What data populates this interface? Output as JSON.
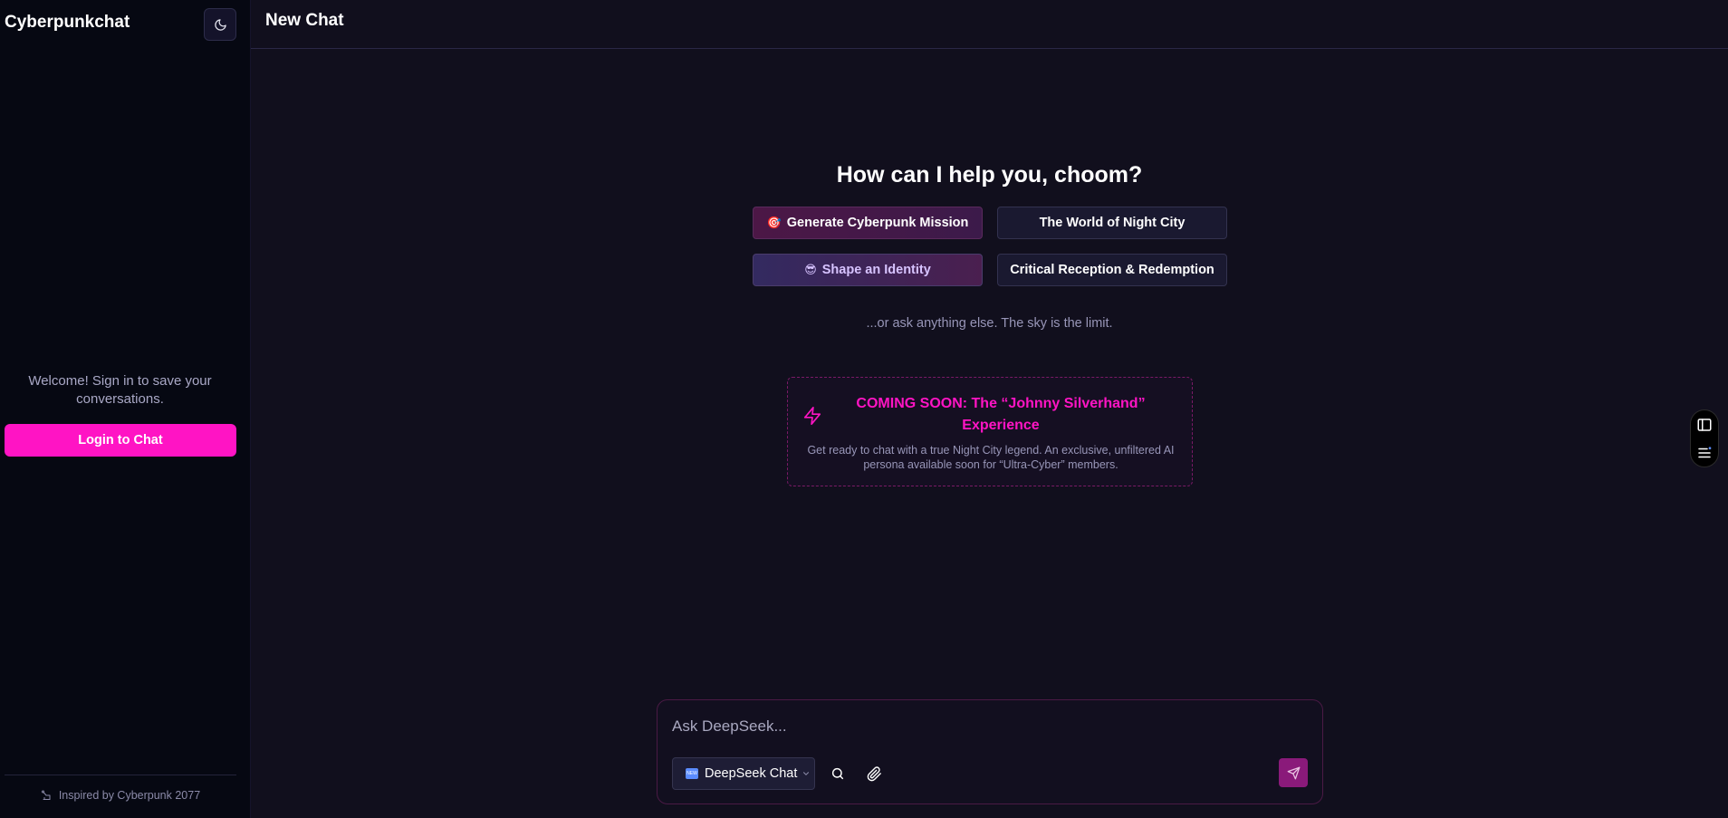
{
  "sidebar": {
    "brand": "Cyberpunkchat",
    "theme_toggle_icon": "moon-icon",
    "welcome_text": "Welcome! Sign in to save your conversations.",
    "login_label": "Login to Chat",
    "footer_icon": "robot-arm-icon",
    "footer_text": "Inspired by Cyberpunk 2077"
  },
  "header": {
    "title": "New Chat"
  },
  "main": {
    "hero_title": "How can I help you, choom?",
    "suggestions": [
      {
        "emoji": "🎯",
        "label": "Generate Cyberpunk Mission"
      },
      {
        "emoji": "",
        "label": "The World of Night City"
      },
      {
        "emoji": "😎",
        "label": "Shape an Identity"
      },
      {
        "emoji": "",
        "label": "Critical Reception & Redemption"
      }
    ],
    "hint": "...or ask anything else. The sky is the limit.",
    "promo": {
      "icon": "lightning-icon",
      "title": "COMING SOON: The “Johnny Silverhand” Experience",
      "text": "Get ready to chat with a true Night City legend. An exclusive, unfiltered AI persona available soon for “Ultra-Cyber” members."
    }
  },
  "composer": {
    "placeholder": "Ask DeepSeek...",
    "model_label": "DeepSeek Chat",
    "model_badge": "NEW",
    "search_icon": "search-icon",
    "attach_icon": "paperclip-icon",
    "send_icon": "send-icon"
  },
  "colors": {
    "accent": "#ff14c4",
    "background": "#110f1d",
    "sidebar": "#060812"
  }
}
